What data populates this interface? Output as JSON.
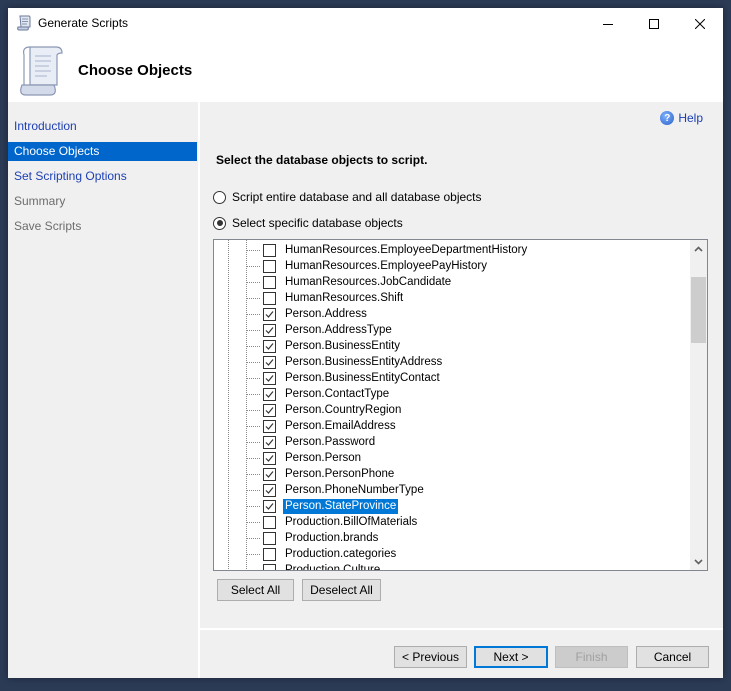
{
  "window": {
    "title": "Generate Scripts",
    "title_icon": "scroll-icon",
    "controls": [
      "minimize-icon",
      "maximize-icon",
      "close-icon"
    ]
  },
  "header": {
    "title": "Choose Objects",
    "icon": "scroll-icon"
  },
  "nav": {
    "items": [
      {
        "label": "Introduction",
        "state": "link"
      },
      {
        "label": "Choose Objects",
        "state": "selected"
      },
      {
        "label": "Set Scripting Options",
        "state": "link"
      },
      {
        "label": "Summary",
        "state": "disabled"
      },
      {
        "label": "Save Scripts",
        "state": "disabled"
      }
    ]
  },
  "content": {
    "help_label": "Help",
    "instruction": "Select the database objects to script.",
    "options": [
      {
        "label": "Script entire database and all database objects",
        "checked": false
      },
      {
        "label": "Select specific database objects",
        "checked": true
      }
    ],
    "tree_items": [
      {
        "label": "HumanResources.EmployeeDepartmentHistory",
        "checked": false,
        "selected": false
      },
      {
        "label": "HumanResources.EmployeePayHistory",
        "checked": false,
        "selected": false
      },
      {
        "label": "HumanResources.JobCandidate",
        "checked": false,
        "selected": false
      },
      {
        "label": "HumanResources.Shift",
        "checked": false,
        "selected": false
      },
      {
        "label": "Person.Address",
        "checked": true,
        "selected": false
      },
      {
        "label": "Person.AddressType",
        "checked": true,
        "selected": false
      },
      {
        "label": "Person.BusinessEntity",
        "checked": true,
        "selected": false
      },
      {
        "label": "Person.BusinessEntityAddress",
        "checked": true,
        "selected": false
      },
      {
        "label": "Person.BusinessEntityContact",
        "checked": true,
        "selected": false
      },
      {
        "label": "Person.ContactType",
        "checked": true,
        "selected": false
      },
      {
        "label": "Person.CountryRegion",
        "checked": true,
        "selected": false
      },
      {
        "label": "Person.EmailAddress",
        "checked": true,
        "selected": false
      },
      {
        "label": "Person.Password",
        "checked": true,
        "selected": false
      },
      {
        "label": "Person.Person",
        "checked": true,
        "selected": false
      },
      {
        "label": "Person.PersonPhone",
        "checked": true,
        "selected": false
      },
      {
        "label": "Person.PhoneNumberType",
        "checked": true,
        "selected": false
      },
      {
        "label": "Person.StateProvince",
        "checked": true,
        "selected": true
      },
      {
        "label": "Production.BillOfMaterials",
        "checked": false,
        "selected": false
      },
      {
        "label": "Production.brands",
        "checked": false,
        "selected": false
      },
      {
        "label": "Production.categories",
        "checked": false,
        "selected": false
      },
      {
        "label": "Production.Culture",
        "checked": false,
        "selected": false
      }
    ],
    "select_all_label": "Select All",
    "deselect_all_label": "Deselect All"
  },
  "footer": {
    "previous_label": "< Previous",
    "next_label": "Next >",
    "finish_label": "Finish",
    "cancel_label": "Cancel"
  },
  "colors": {
    "accent": "#0066cc",
    "link": "#1c3fb5",
    "selection": "#0078d7",
    "desktop": "#2b3a55"
  }
}
